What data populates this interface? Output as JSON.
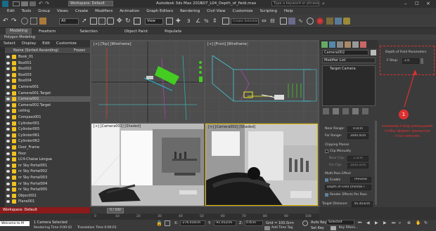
{
  "window": {
    "workspace": "Workspace: Default",
    "title": "Autodesk 3ds Max 2016",
    "filename": "507_L04_Depth_of_field.max",
    "search_placeholder": "Type a keyword or phrase"
  },
  "menu": [
    "Edit",
    "Tools",
    "Group",
    "Views",
    "Create",
    "Modifiers",
    "Animation",
    "Graph Editors",
    "Rendering",
    "Civil View",
    "Customize",
    "Scripting",
    "Help"
  ],
  "toolbar": {
    "selection_filter": "All",
    "view_dropdown": "View",
    "named_sel": "Create Selection Se"
  },
  "ribbon": {
    "tabs": [
      "Modeling",
      "Freeform",
      "Selection",
      "Object Paint",
      "Populate"
    ],
    "sub": "Polygon Modeling"
  },
  "scene_explorer": {
    "tabs": [
      "Select",
      "Display",
      "Edit",
      "Customize"
    ],
    "header_name": "Name (Sorted Ascending)",
    "header_frozen": "Frozen",
    "items": [
      "Book_01",
      "Box001",
      "Box002",
      "Box003",
      "Box004",
      "Camera001",
      "Camera001.Target",
      "Camera002",
      "Camera002.Target",
      "ceiling",
      "Compass001",
      "Cylinder001",
      "Cylinder005",
      "Cylinder061",
      "Cylinder062",
      "Door_Frame",
      "floor",
      "LC4-Chaise Longue",
      "nr Sky Portal001",
      "nr Sky Portal002",
      "nr Sky Portal003",
      "nr Sky Portal004",
      "nr Sky Portal005",
      "Object001",
      "Plane001"
    ],
    "selected_index": 7
  },
  "viewports": {
    "top": "[+] [Top] [Wireframe]",
    "front": "[+] [Front] [Wireframe]",
    "camera001": "[+] [Camera001] [Shaded]",
    "camera002": "[+] [Camera002] [Shaded]"
  },
  "command_panel": {
    "object_name": "Camera002",
    "modifier_list": "Modifier List",
    "stack_item": "Target Camera",
    "near_range_label": "Near Range:",
    "near_range": "0.0cm",
    "far_range_label": "Far Range:",
    "far_range": "1000.0cm",
    "clipping_planes": "Clipping Planes",
    "clip_manually": "Clip Manually",
    "near_clip_label": "Near Clip:",
    "near_clip": "1.0cm",
    "far_clip_label": "Far Clip:",
    "far_clip": "1000.0cm",
    "multipass": "Multi-Pass Effect",
    "enable": "Enable",
    "preview": "Preview",
    "effect": "Depth of Field (mental r",
    "render_effects": "Render Effects Per Pass",
    "target_distance_label": "Target Distance:",
    "target_distance": "95.403cm"
  },
  "dof_panel": {
    "title": "Depth of Field Parameters",
    "fstop_label": "F-Stop:",
    "fstop": "2.0",
    "annotation_number": "1",
    "annotation_text": "значение f-stop уменьшаем чтобы эффект размытия стал сильнее"
  },
  "timeline": {
    "frame": "0 / 100",
    "ticks": [
      "0",
      "10",
      "20",
      "30",
      "40",
      "50",
      "60",
      "70",
      "80",
      "90",
      "100"
    ]
  },
  "status": {
    "workspace": "Workspace: Default",
    "welcome": "Welcome to M",
    "selected": "1 Camera Selected",
    "render_time": "Rendering Time 0:00:42",
    "translation_time": "Translation Time 0:00:01",
    "x_label": "X:",
    "x": "-276.016cm",
    "y_label": "Y:",
    "y": "-91.052cm",
    "z_label": "Z:",
    "z": "0.0cm",
    "grid": "Grid = 100.0cm",
    "auto_key": "Auto Key",
    "set_key": "Set Key",
    "selected_dd": "Selected",
    "key_filters": "Key Filters...",
    "add_time_tag": "Add Time Tag"
  },
  "colors": {
    "accent": "#1a5a8a",
    "annotation_red": "#e03030",
    "selection_wire": "#ffffff",
    "camera_green": "#44cc22"
  }
}
